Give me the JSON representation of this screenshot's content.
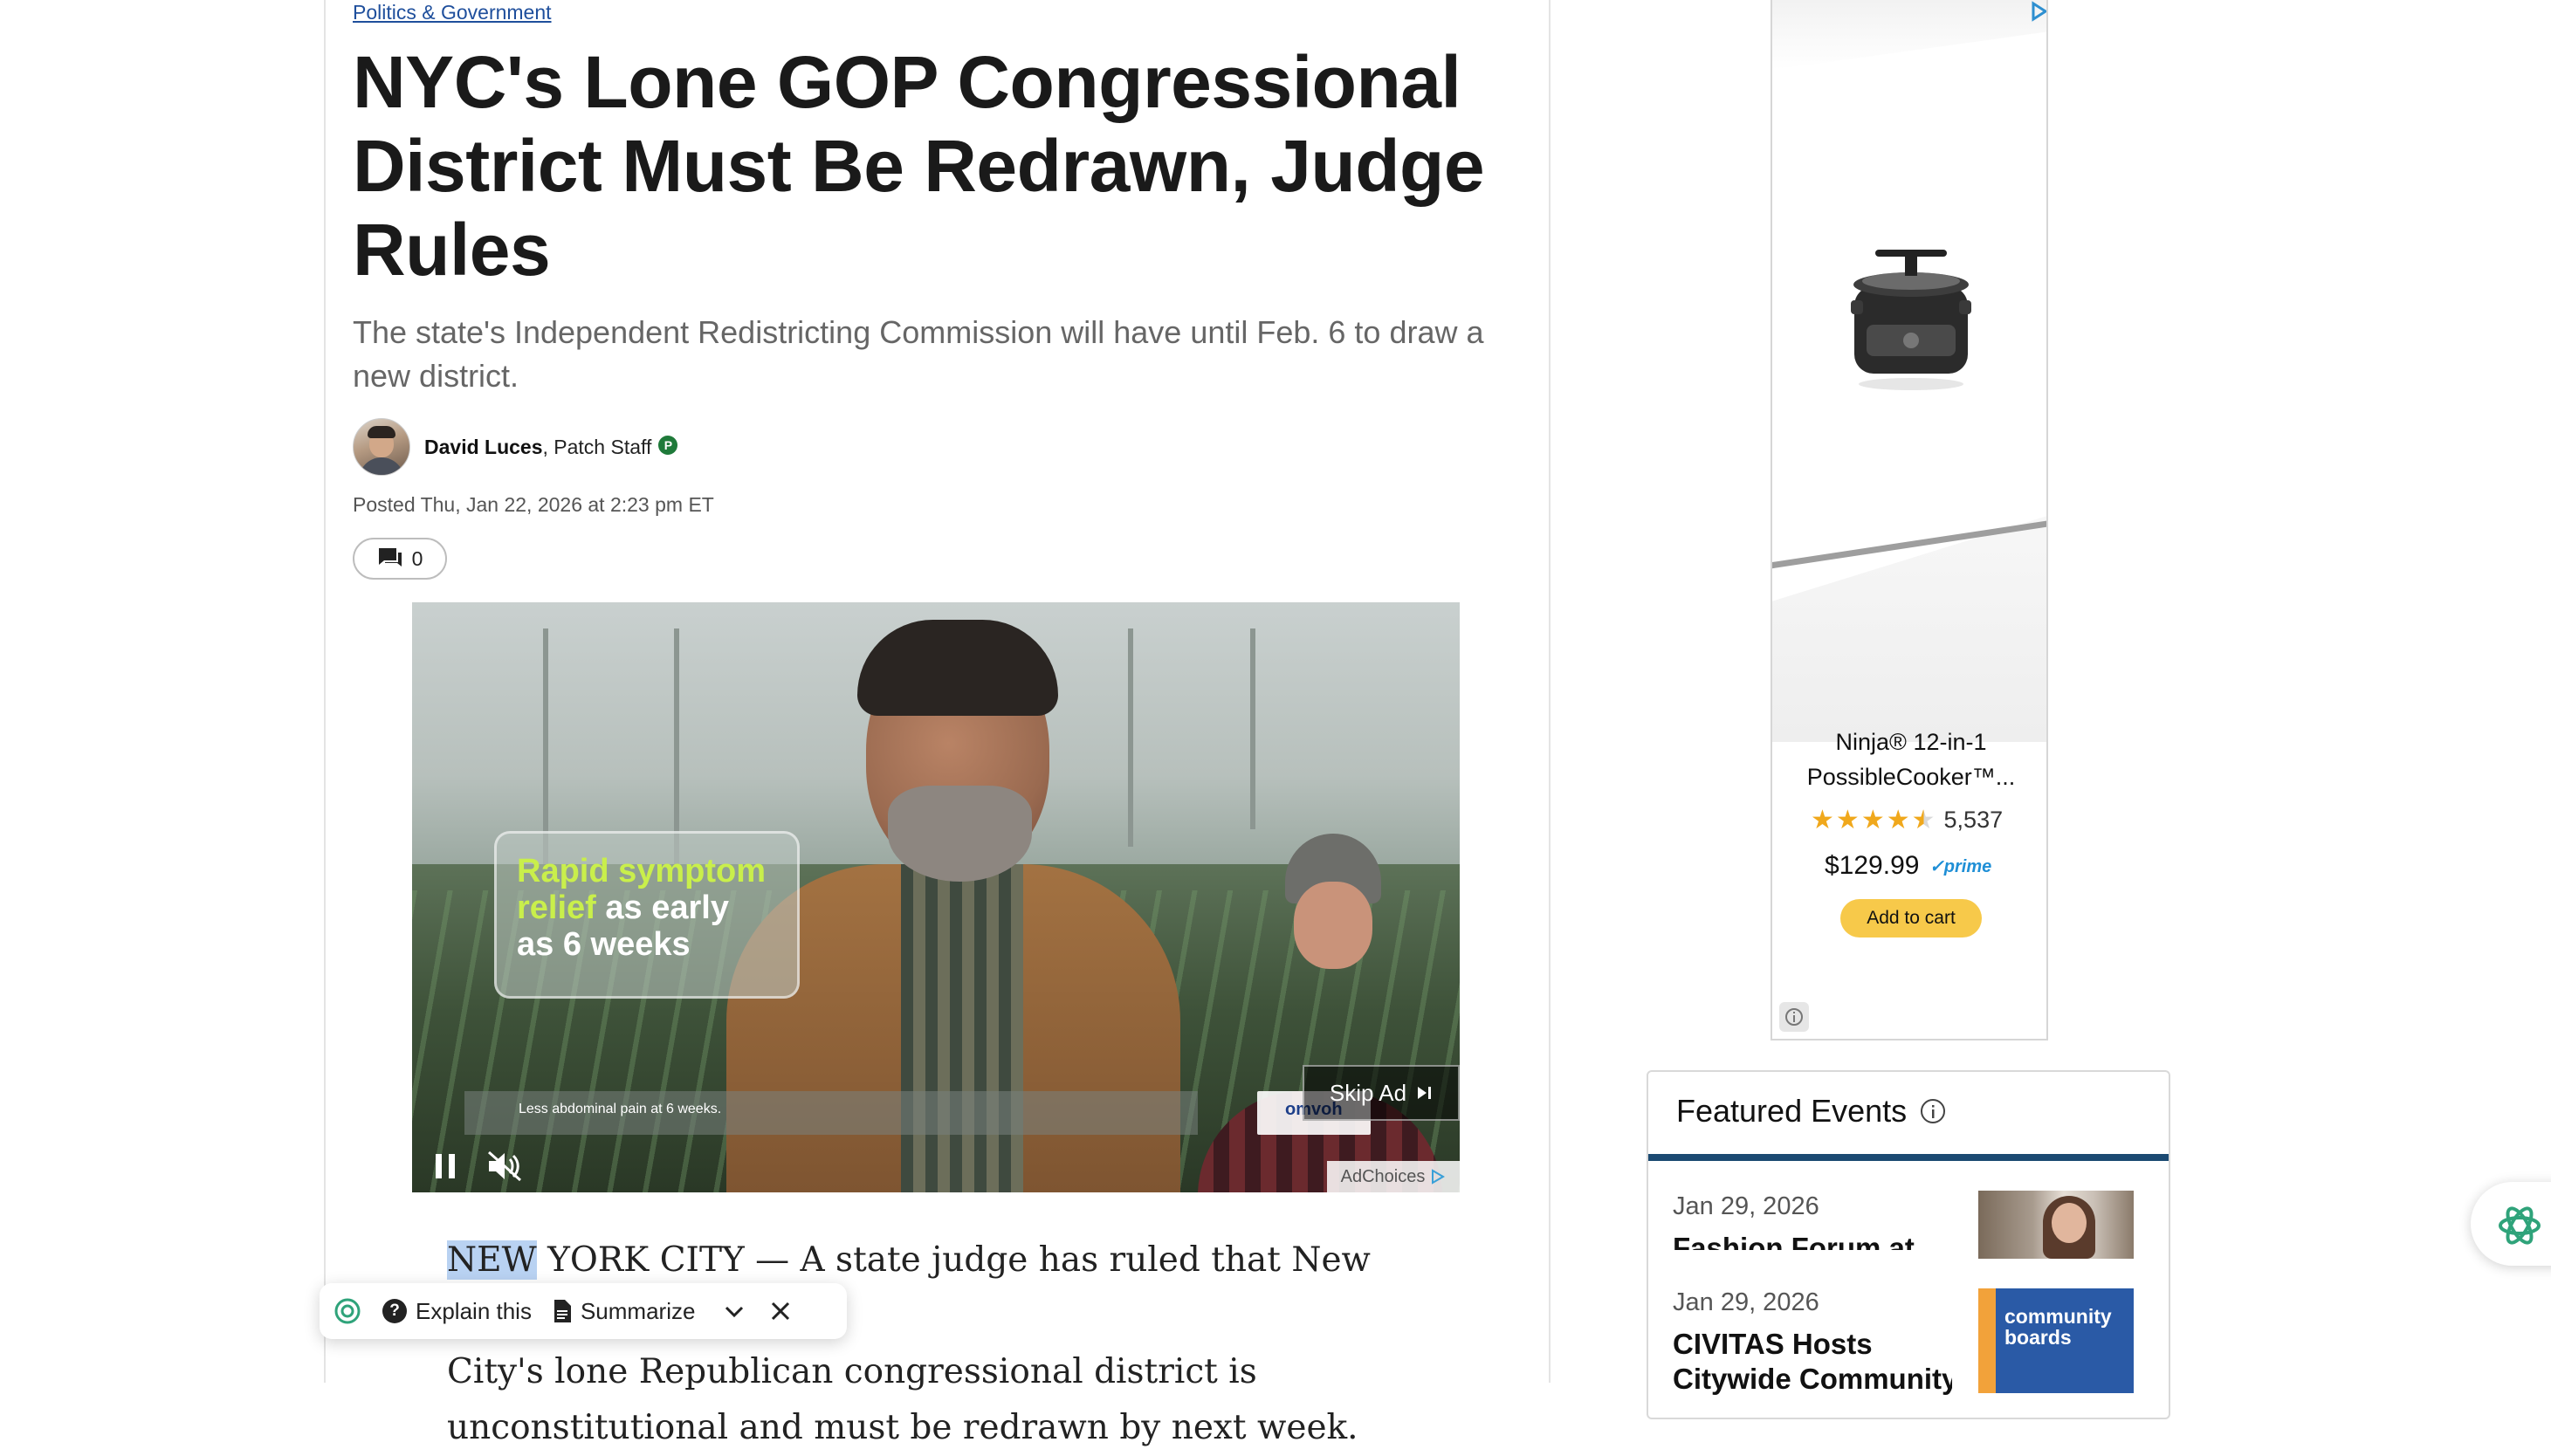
{
  "article": {
    "category": "Politics & Government",
    "headline": "NYC's Lone GOP Congressional District Must Be Redrawn, Judge Rules",
    "subhead": "The state's Independent Redistricting Commission will have until Feb. 6 to draw a new district.",
    "author_name": "David Luces",
    "author_role": ", Patch Staff",
    "author_badge": "P",
    "posted": "Posted Thu, Jan 22, 2026 at 2:23 pm ET",
    "comment_count": "0",
    "body_highlight": "NEW",
    "body_line1_rest": " YORK CITY — A state judge has ruled that New York",
    "body_line2": "City's lone Republican congressional district is",
    "body_line3": "unconstitutional and must be redrawn by next week."
  },
  "video_ad": {
    "overlay_line1_green": "Rapid symptom",
    "overlay_line2_green": "relief",
    "overlay_line2_white": " as early",
    "overlay_line3": "as 6 weeks",
    "caption": "Less abdominal pain at 6 weeks.",
    "brand_logo": "omvoh",
    "skip_label": "Skip Ad",
    "adchoices_label": "AdChoices"
  },
  "ai_toolbar": {
    "explain_label": "Explain this",
    "summarize_label": "Summarize"
  },
  "sidebar_ad": {
    "product_name": "Ninja® 12-in-1 PossibleCooker™...",
    "review_count": "5,537",
    "rating": 4.5,
    "price": "$129.99",
    "prime": "✓prime",
    "cta": "Add to cart"
  },
  "featured_events": {
    "title": "Featured Events",
    "events": [
      {
        "date": "Jan 29, 2026",
        "title": "Fashion Forum at"
      },
      {
        "date": "Jan 29, 2026",
        "title": "CIVITAS Hosts",
        "title_line2": "Citywide Community",
        "thumb_text": "community boards"
      }
    ]
  },
  "colors": {
    "link": "#1f4f9c",
    "events_rule": "#1b4a72",
    "cart_button": "#f7c94a",
    "highlight": "#b9d2f2"
  }
}
